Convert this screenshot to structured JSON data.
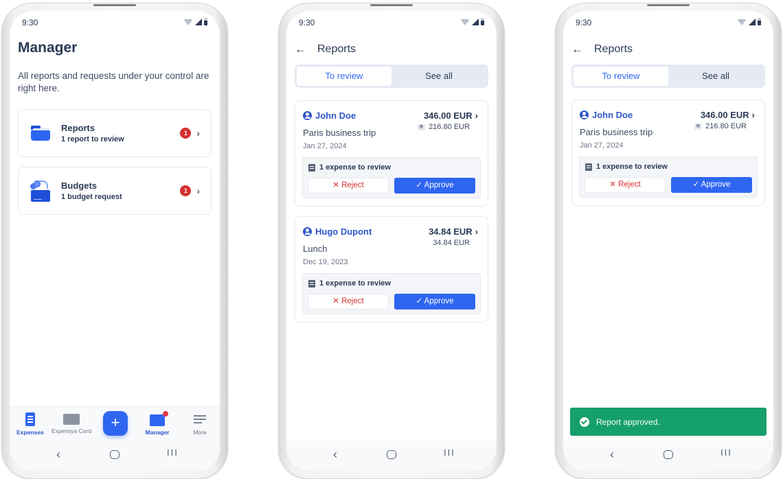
{
  "status_bar": {
    "time": "9:30"
  },
  "screen1": {
    "title": "Manager",
    "description": "All reports and requests under your control are right here.",
    "menu": [
      {
        "title": "Reports",
        "subtitle": "1 report to review",
        "badge": "1",
        "icon": "folder-icon"
      },
      {
        "title": "Budgets",
        "subtitle": "1 budget request",
        "badge": "1",
        "icon": "budget-icon"
      }
    ],
    "tabbar": [
      {
        "label": "Expenses",
        "icon": "expenses-icon",
        "active": true
      },
      {
        "label": "Expensya Card",
        "icon": "card-icon",
        "active": false
      },
      {
        "label": "+",
        "icon": "plus-icon"
      },
      {
        "label": "Manager",
        "icon": "manager-icon",
        "active": true,
        "notification": true
      },
      {
        "label": "More",
        "icon": "menu-icon",
        "active": false
      }
    ]
  },
  "reports_screen": {
    "title": "Reports",
    "back_icon": "←",
    "segments": [
      {
        "label": "To review",
        "active": true
      },
      {
        "label": "See all",
        "active": false
      }
    ]
  },
  "screen2": {
    "reports": [
      {
        "employee": "John Doe",
        "purpose": "Paris business trip",
        "date": "Jan 27, 2024",
        "amount": "346.00 EUR",
        "reimbursable_tag": "R",
        "reimbursable_amount": "216.80 EUR",
        "expenses_label": "1 expense to review",
        "reject_label": "Reject",
        "approve_label": "Approve"
      },
      {
        "employee": "Hugo Dupont",
        "purpose": "Lunch",
        "date": "Dec 19, 2023",
        "amount": "34.84 EUR",
        "reimbursable_amount": "34.84 EUR",
        "expenses_label": "1 expense to review",
        "reject_label": "Reject",
        "approve_label": "Approve"
      }
    ]
  },
  "screen3": {
    "reports": [
      {
        "employee": "John Doe",
        "purpose": "Paris business trip",
        "date": "Jan 27, 2024",
        "amount": "346.00 EUR",
        "reimbursable_tag": "R",
        "reimbursable_amount": "216.80 EUR",
        "expenses_label": "1 expense to review",
        "reject_label": "Reject",
        "approve_label": "Approve"
      }
    ],
    "toast": "Report approved."
  },
  "nav": {
    "back": "‹",
    "recent": "III"
  },
  "glyphs": {
    "chevron": "›",
    "x": "✕",
    "check": "✓"
  },
  "colors": {
    "primary": "#2f66f0",
    "danger": "#d42f2f",
    "success": "#16a06b",
    "text": "#2b3a55"
  }
}
